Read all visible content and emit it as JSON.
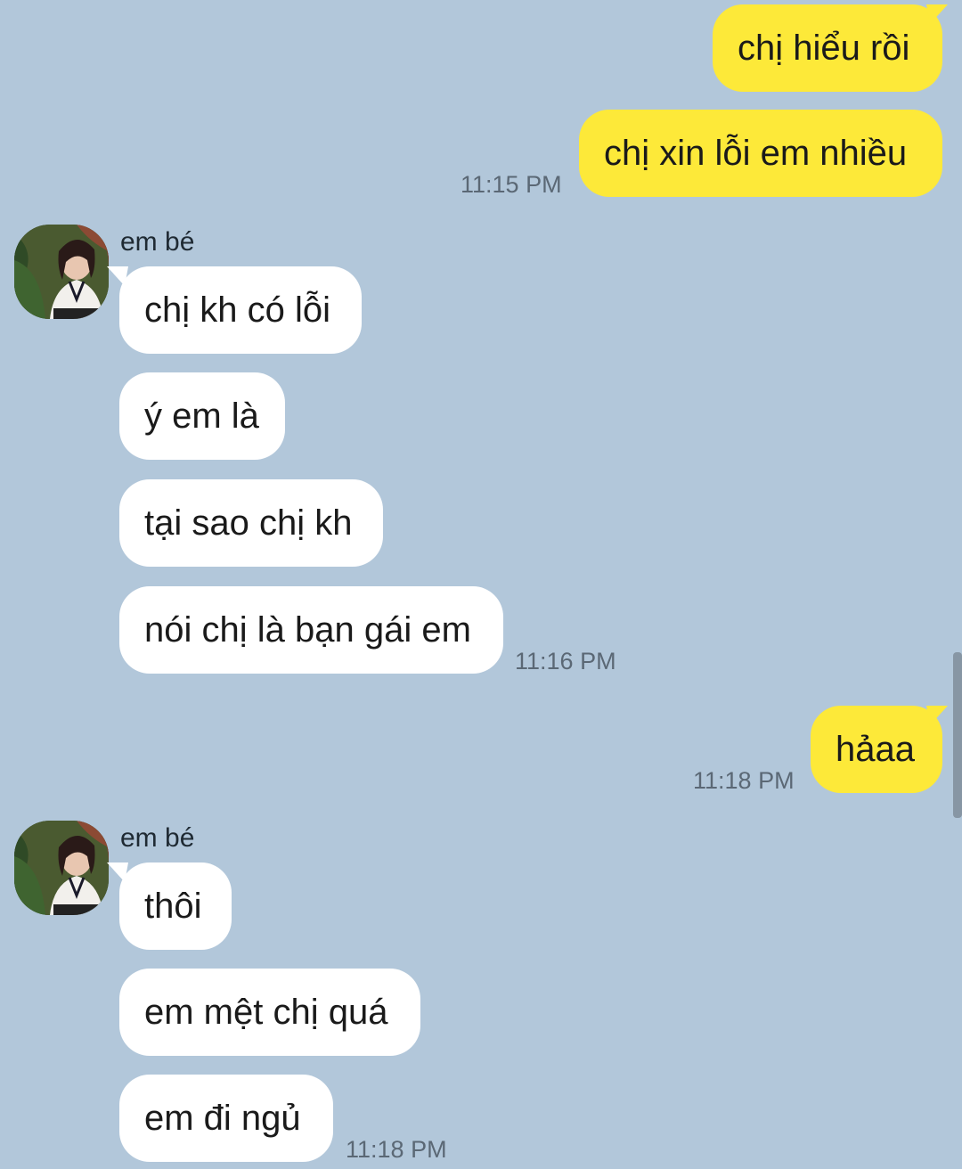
{
  "colors": {
    "background": "#b2c7da",
    "outgoing_bubble": "#fde939",
    "incoming_bubble": "#ffffff",
    "timestamp": "#5b6875"
  },
  "messages": [
    {
      "direction": "out",
      "text": "chị hiểu rồi"
    },
    {
      "direction": "out",
      "text": "chị xin lỗi em nhiều",
      "time": "11:15 PM"
    },
    {
      "direction": "in",
      "sender": "em bé",
      "text": "chị kh có lỗi"
    },
    {
      "direction": "in",
      "text": "ý em là"
    },
    {
      "direction": "in",
      "text": "tại sao chị kh"
    },
    {
      "direction": "in",
      "text": "nói chị là bạn gái em",
      "time": "11:16 PM"
    },
    {
      "direction": "out",
      "text": "hảaa",
      "time": "11:18 PM"
    },
    {
      "direction": "in",
      "sender": "em bé",
      "text": "thôi"
    },
    {
      "direction": "in",
      "text": "em mệt chị quá"
    },
    {
      "direction": "in",
      "text": "em đi ngủ",
      "time": "11:18 PM"
    }
  ],
  "avatar_icon": "profile-photo-avatar"
}
